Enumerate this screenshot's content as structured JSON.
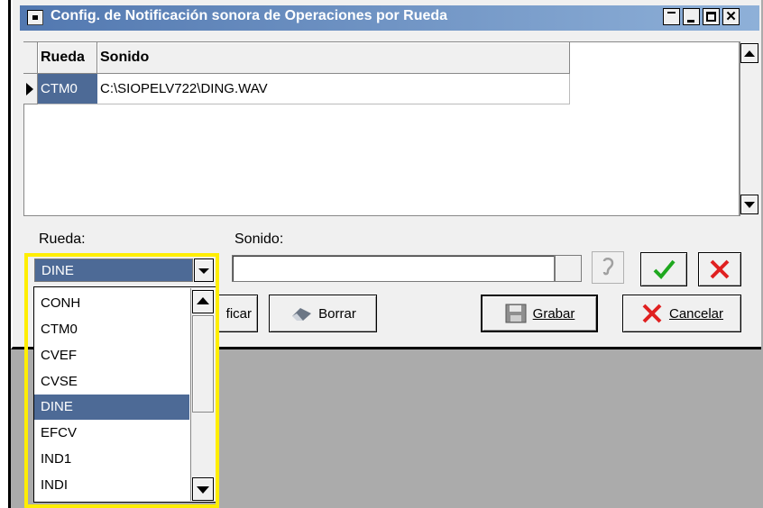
{
  "window": {
    "title": "Config. de Notificación sonora de Operaciones por Rueda",
    "title_bar_buttons": [
      "restore-icon",
      "minimize-icon",
      "maximize-icon",
      "close-icon"
    ]
  },
  "grid": {
    "columns": [
      "Rueda",
      "Sonido"
    ],
    "rows": [
      {
        "rueda": "CTM0",
        "sonido": "C:\\SIOPELV722\\DING.WAV"
      }
    ]
  },
  "form": {
    "rueda_label": "Rueda:",
    "rueda_value": "DINE",
    "sonido_label": "Sonido:",
    "sonido_value": ""
  },
  "dropdown": {
    "options": [
      "CONH",
      "CTM0",
      "CVEF",
      "CVSE",
      "DINE",
      "EFCV",
      "IND1",
      "INDI"
    ],
    "selected": "DINE"
  },
  "buttons": {
    "modificar_partial": "ficar",
    "borrar": "Borrar",
    "grabar": "Grabar",
    "cancelar": "Cancelar"
  },
  "colors": {
    "titlebar_start": "#5278b0",
    "selection": "#4d6a96",
    "highlight": "#ffee00",
    "confirm_green": "#1fa81f",
    "cancel_red": "#e02020"
  }
}
